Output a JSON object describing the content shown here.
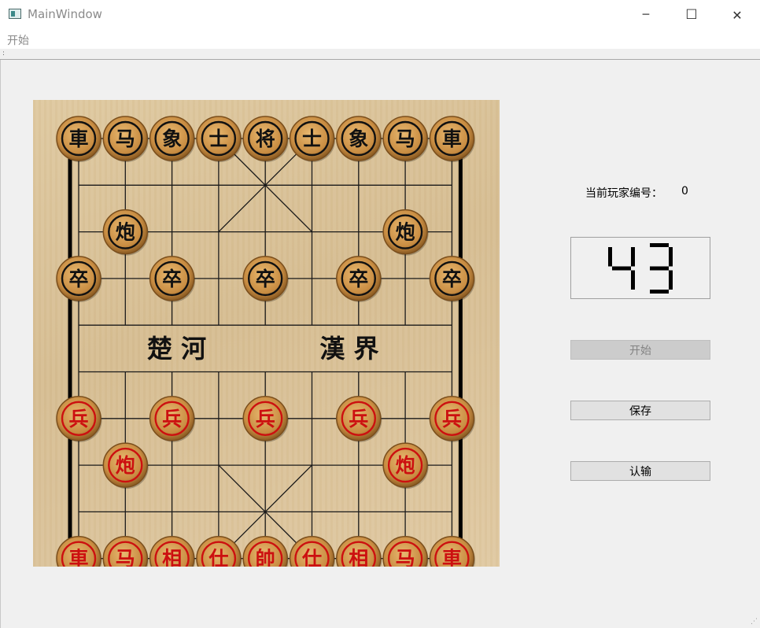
{
  "window": {
    "title": "MainWindow",
    "controls": {
      "minimize": "─",
      "maximize": "☐",
      "close": "✕"
    }
  },
  "menu": {
    "items": [
      "开始"
    ]
  },
  "info": {
    "player_label": "当前玩家编号：",
    "player_value": "0"
  },
  "timer": {
    "value": "43"
  },
  "buttons": {
    "start": "开始",
    "save": "保存",
    "resign": "认输"
  },
  "board": {
    "river_left": "楚 河",
    "river_right": "漢 界",
    "colors": {
      "black": "#111111",
      "red": "#cc1010",
      "line": "#1a1a1a"
    },
    "pieces": [
      {
        "t": "車",
        "c": "black",
        "col": 0,
        "row": 0
      },
      {
        "t": "马",
        "c": "black",
        "col": 1,
        "row": 0
      },
      {
        "t": "象",
        "c": "black",
        "col": 2,
        "row": 0
      },
      {
        "t": "士",
        "c": "black",
        "col": 3,
        "row": 0
      },
      {
        "t": "将",
        "c": "black",
        "col": 4,
        "row": 0
      },
      {
        "t": "士",
        "c": "black",
        "col": 5,
        "row": 0
      },
      {
        "t": "象",
        "c": "black",
        "col": 6,
        "row": 0
      },
      {
        "t": "马",
        "c": "black",
        "col": 7,
        "row": 0
      },
      {
        "t": "車",
        "c": "black",
        "col": 8,
        "row": 0
      },
      {
        "t": "炮",
        "c": "black",
        "col": 1,
        "row": 2
      },
      {
        "t": "炮",
        "c": "black",
        "col": 7,
        "row": 2
      },
      {
        "t": "卒",
        "c": "black",
        "col": 0,
        "row": 3
      },
      {
        "t": "卒",
        "c": "black",
        "col": 2,
        "row": 3
      },
      {
        "t": "卒",
        "c": "black",
        "col": 4,
        "row": 3
      },
      {
        "t": "卒",
        "c": "black",
        "col": 6,
        "row": 3
      },
      {
        "t": "卒",
        "c": "black",
        "col": 8,
        "row": 3
      },
      {
        "t": "兵",
        "c": "red",
        "col": 0,
        "row": 6
      },
      {
        "t": "兵",
        "c": "red",
        "col": 2,
        "row": 6
      },
      {
        "t": "兵",
        "c": "red",
        "col": 4,
        "row": 6
      },
      {
        "t": "兵",
        "c": "red",
        "col": 6,
        "row": 6
      },
      {
        "t": "兵",
        "c": "red",
        "col": 8,
        "row": 6
      },
      {
        "t": "炮",
        "c": "red",
        "col": 1,
        "row": 7
      },
      {
        "t": "炮",
        "c": "red",
        "col": 7,
        "row": 7
      },
      {
        "t": "車",
        "c": "red",
        "col": 0,
        "row": 9
      },
      {
        "t": "马",
        "c": "red",
        "col": 1,
        "row": 9
      },
      {
        "t": "相",
        "c": "red",
        "col": 2,
        "row": 9
      },
      {
        "t": "仕",
        "c": "red",
        "col": 3,
        "row": 9
      },
      {
        "t": "帥",
        "c": "red",
        "col": 4,
        "row": 9
      },
      {
        "t": "仕",
        "c": "red",
        "col": 5,
        "row": 9
      },
      {
        "t": "相",
        "c": "red",
        "col": 6,
        "row": 9
      },
      {
        "t": "马",
        "c": "red",
        "col": 7,
        "row": 9
      },
      {
        "t": "車",
        "c": "red",
        "col": 8,
        "row": 9
      }
    ]
  }
}
